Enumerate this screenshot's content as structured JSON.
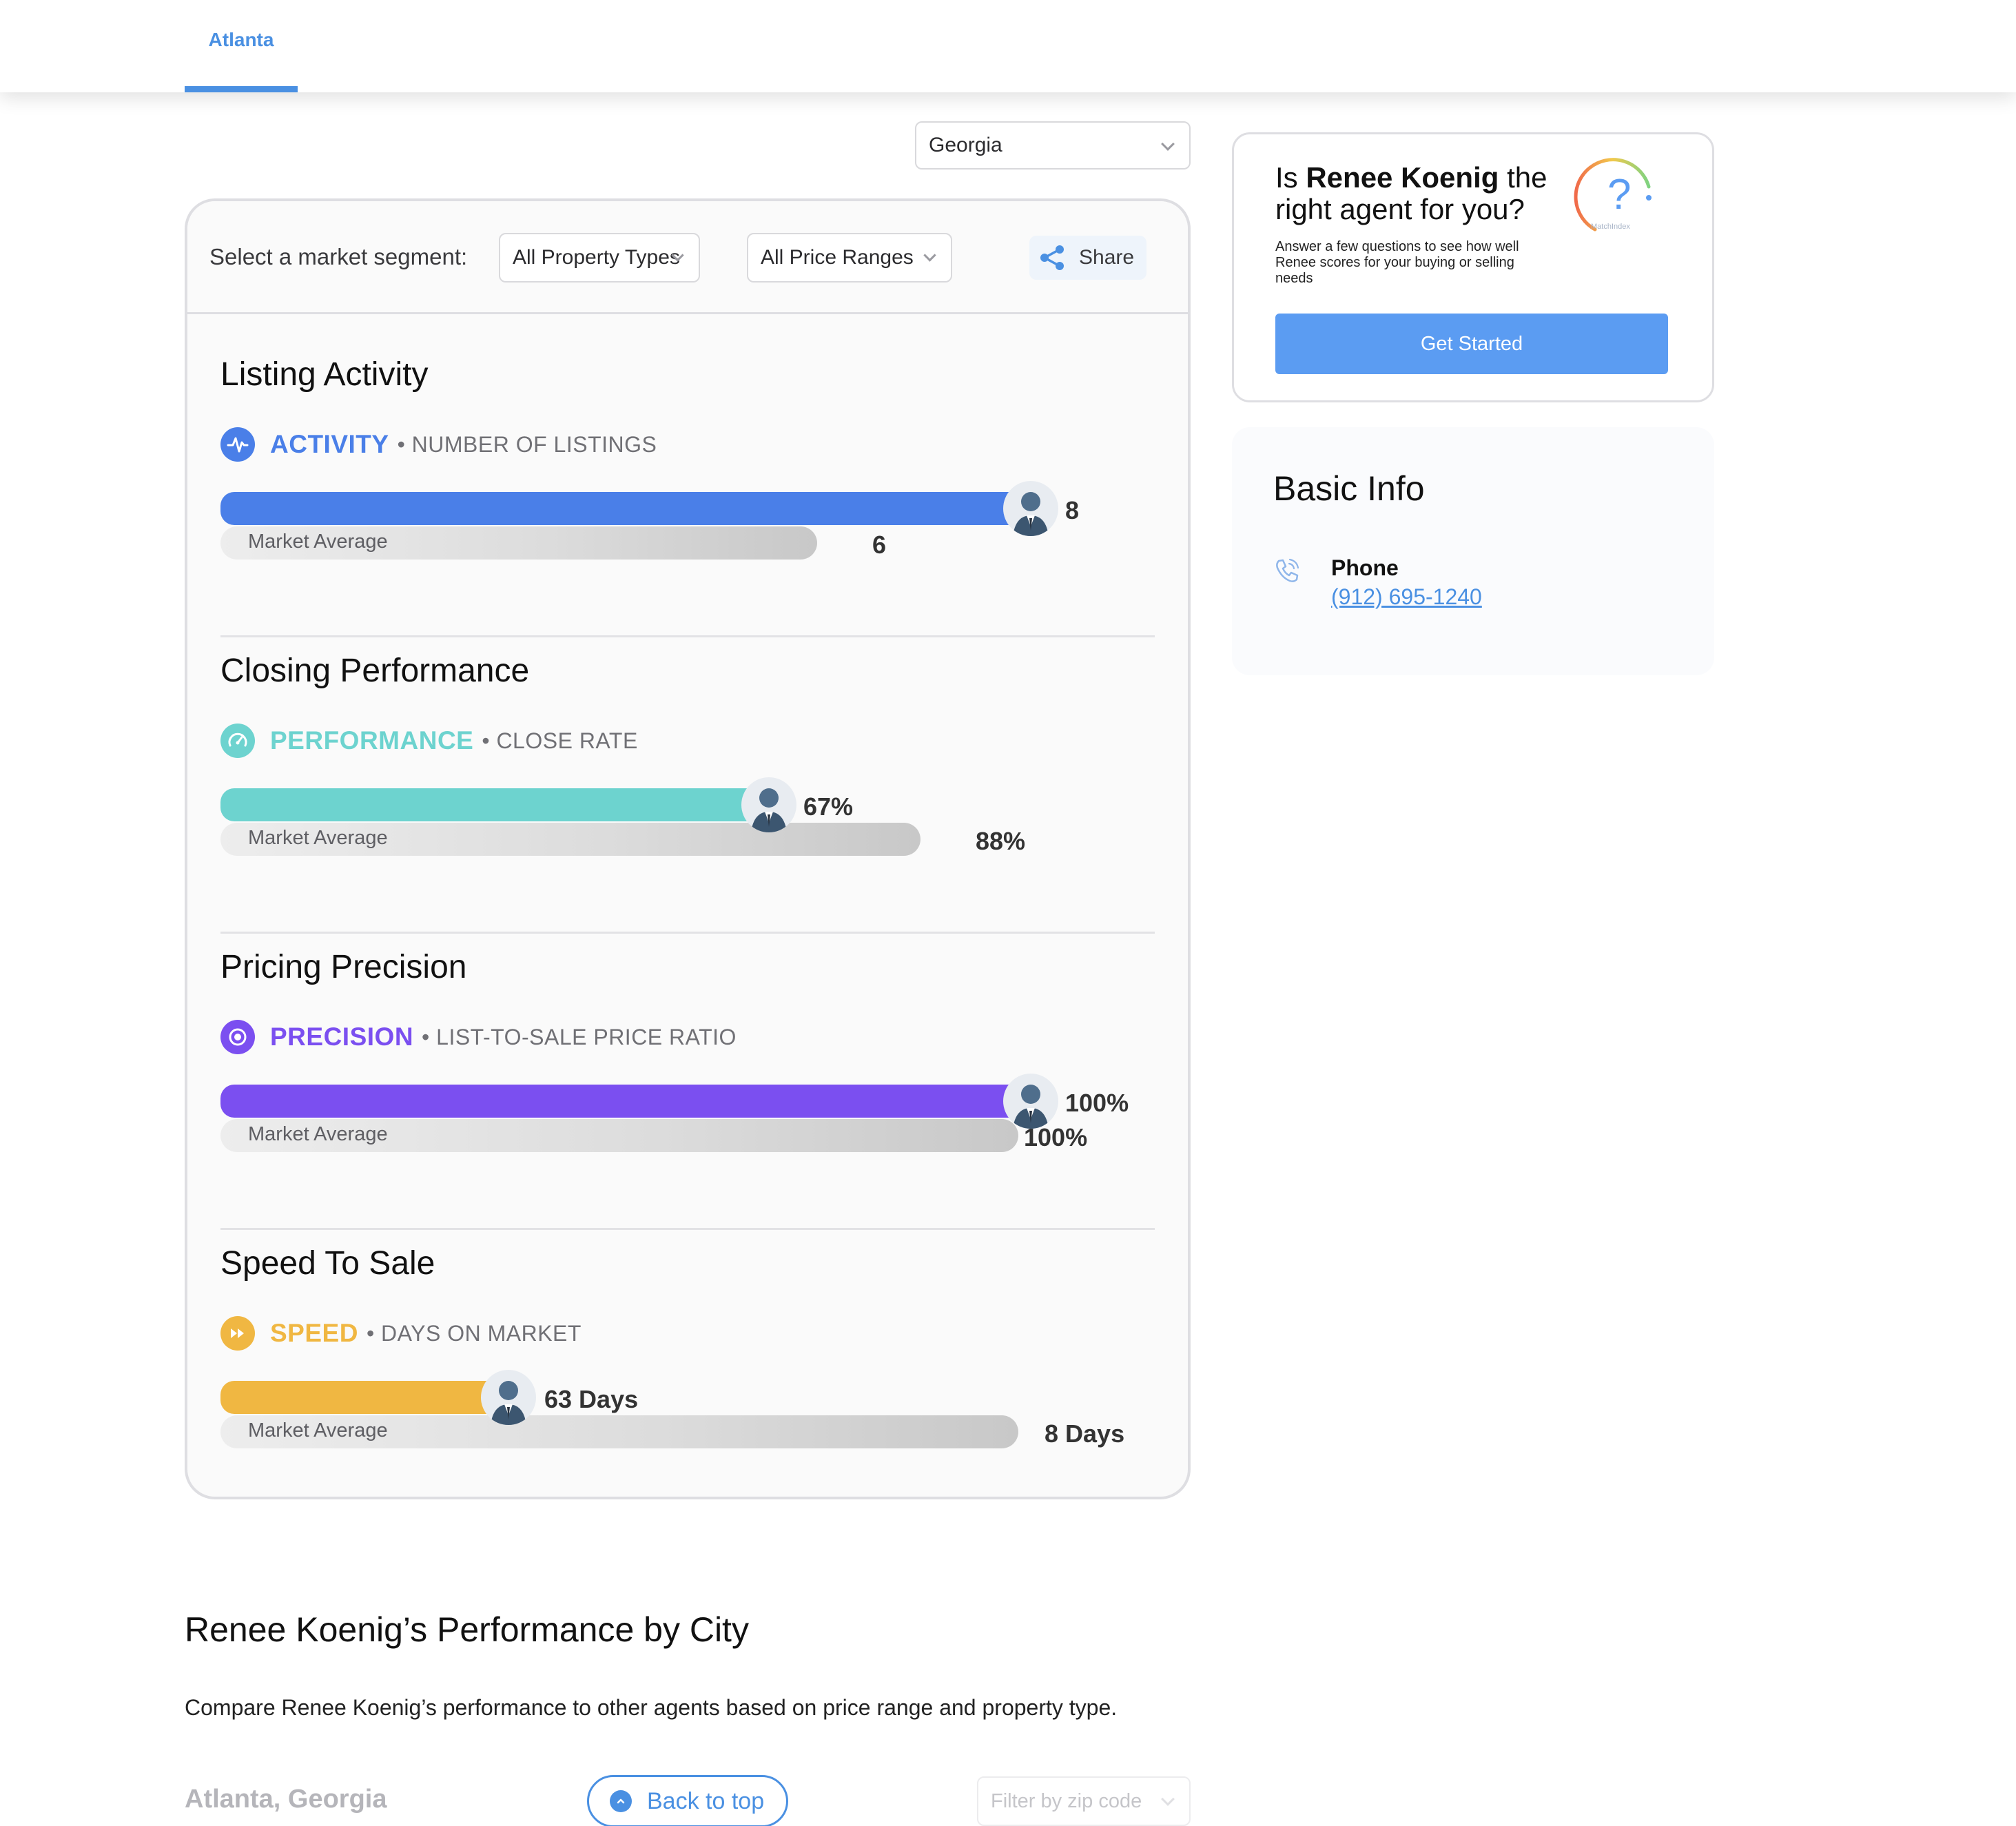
{
  "tabs": [
    {
      "label": "Atlanta",
      "active": true
    }
  ],
  "state_select": {
    "value": "Georgia"
  },
  "segment": {
    "label": "Select a market segment:",
    "property_type": "All Property Types",
    "price_range": "All Price Ranges",
    "share_label": "Share"
  },
  "colors": {
    "activity": "#4a7fe8",
    "performance": "#6dd3cf",
    "precision": "#7b4ff0",
    "speed": "#f0b742",
    "primary_button": "#5b9cf2",
    "link": "#4a90e2"
  },
  "sections": [
    {
      "title": "Listing Activity",
      "metric": "ACTIVITY",
      "sub": "• NUMBER OF LISTINGS",
      "icon": "activity-pulse-icon",
      "agent_value": "8",
      "market_value": "6",
      "market_label": "Market Average",
      "agent_fraction": 1.0,
      "market_fraction": 0.75
    },
    {
      "title": "Closing Performance",
      "metric": "PERFORMANCE",
      "sub": "• CLOSE RATE",
      "icon": "speedometer-icon",
      "agent_value": "67%",
      "market_value": "88%",
      "market_label": "Market Average",
      "agent_fraction": 0.67,
      "market_fraction": 0.88
    },
    {
      "title": "Pricing Precision",
      "metric": "PRECISION",
      "sub": "• LIST-TO-SALE PRICE RATIO",
      "icon": "target-icon",
      "agent_value": "100%",
      "market_value": "100%",
      "market_label": "Market Average",
      "agent_fraction": 1.0,
      "market_fraction": 1.0
    },
    {
      "title": "Speed To Sale",
      "metric": "SPEED",
      "sub": "• DAYS ON MARKET",
      "icon": "fast-forward-icon",
      "agent_value": "63 Days",
      "market_value": "8 Days",
      "market_label": "Market Average",
      "agent_fraction": 0.345,
      "market_fraction": 1.0
    }
  ],
  "match": {
    "title_prefix": "Is ",
    "agent_name": "Renee Koenig",
    "title_suffix": " the right agent for you?",
    "description": "Answer a few questions to see how well Renee scores for your buying or selling needs",
    "gauge_label": "MatchIndex",
    "button_label": "Get Started"
  },
  "basic_info": {
    "title": "Basic Info",
    "phone_label": "Phone",
    "phone_value": "(912) 695-1240"
  },
  "city_section": {
    "title": "Renee Koenig’s Performance by City",
    "description": "Compare Renee Koenig’s performance to other agents based on price range and property type.",
    "city_name": "Atlanta, Georgia",
    "back_to_top": "Back to top",
    "zip_placeholder": "Filter by zip code"
  }
}
